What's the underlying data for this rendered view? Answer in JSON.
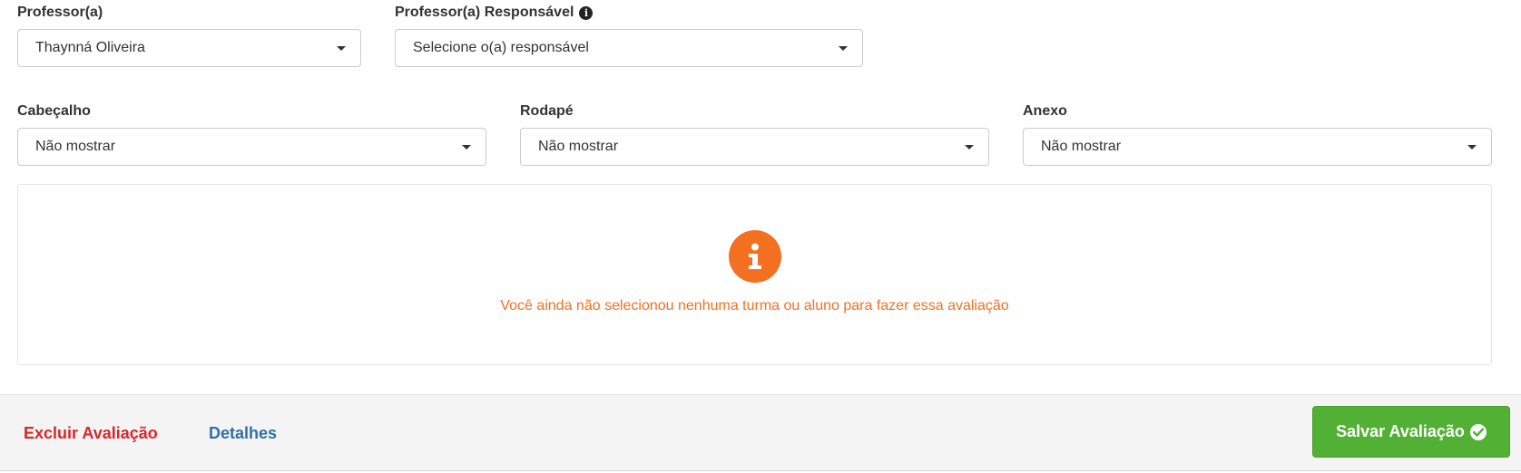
{
  "fields": {
    "professor": {
      "label": "Professor(a)",
      "value": "Thaynná Oliveira"
    },
    "professor_responsavel": {
      "label": "Professor(a) Responsável",
      "placeholder": "Selecione o(a) responsável",
      "info_icon": "info-circle-icon"
    },
    "cabecalho": {
      "label": "Cabeçalho",
      "value": "Não mostrar"
    },
    "rodape": {
      "label": "Rodapé",
      "value": "Não mostrar"
    },
    "anexo": {
      "label": "Anexo",
      "value": "Não mostrar"
    }
  },
  "empty_state": {
    "icon": "info-circle-icon",
    "message": "Você ainda não selecionou nenhuma turma ou aluno para fazer essa avaliação"
  },
  "footer": {
    "delete_label": "Excluir Avaliação",
    "details_label": "Detalhes",
    "save_label": "Salvar Avaliação",
    "save_icon": "check-circle-icon"
  },
  "colors": {
    "accent_orange": "#f37021",
    "delete_red": "#d9262a",
    "link_blue": "#2f6fa7",
    "save_green": "#52b035"
  }
}
